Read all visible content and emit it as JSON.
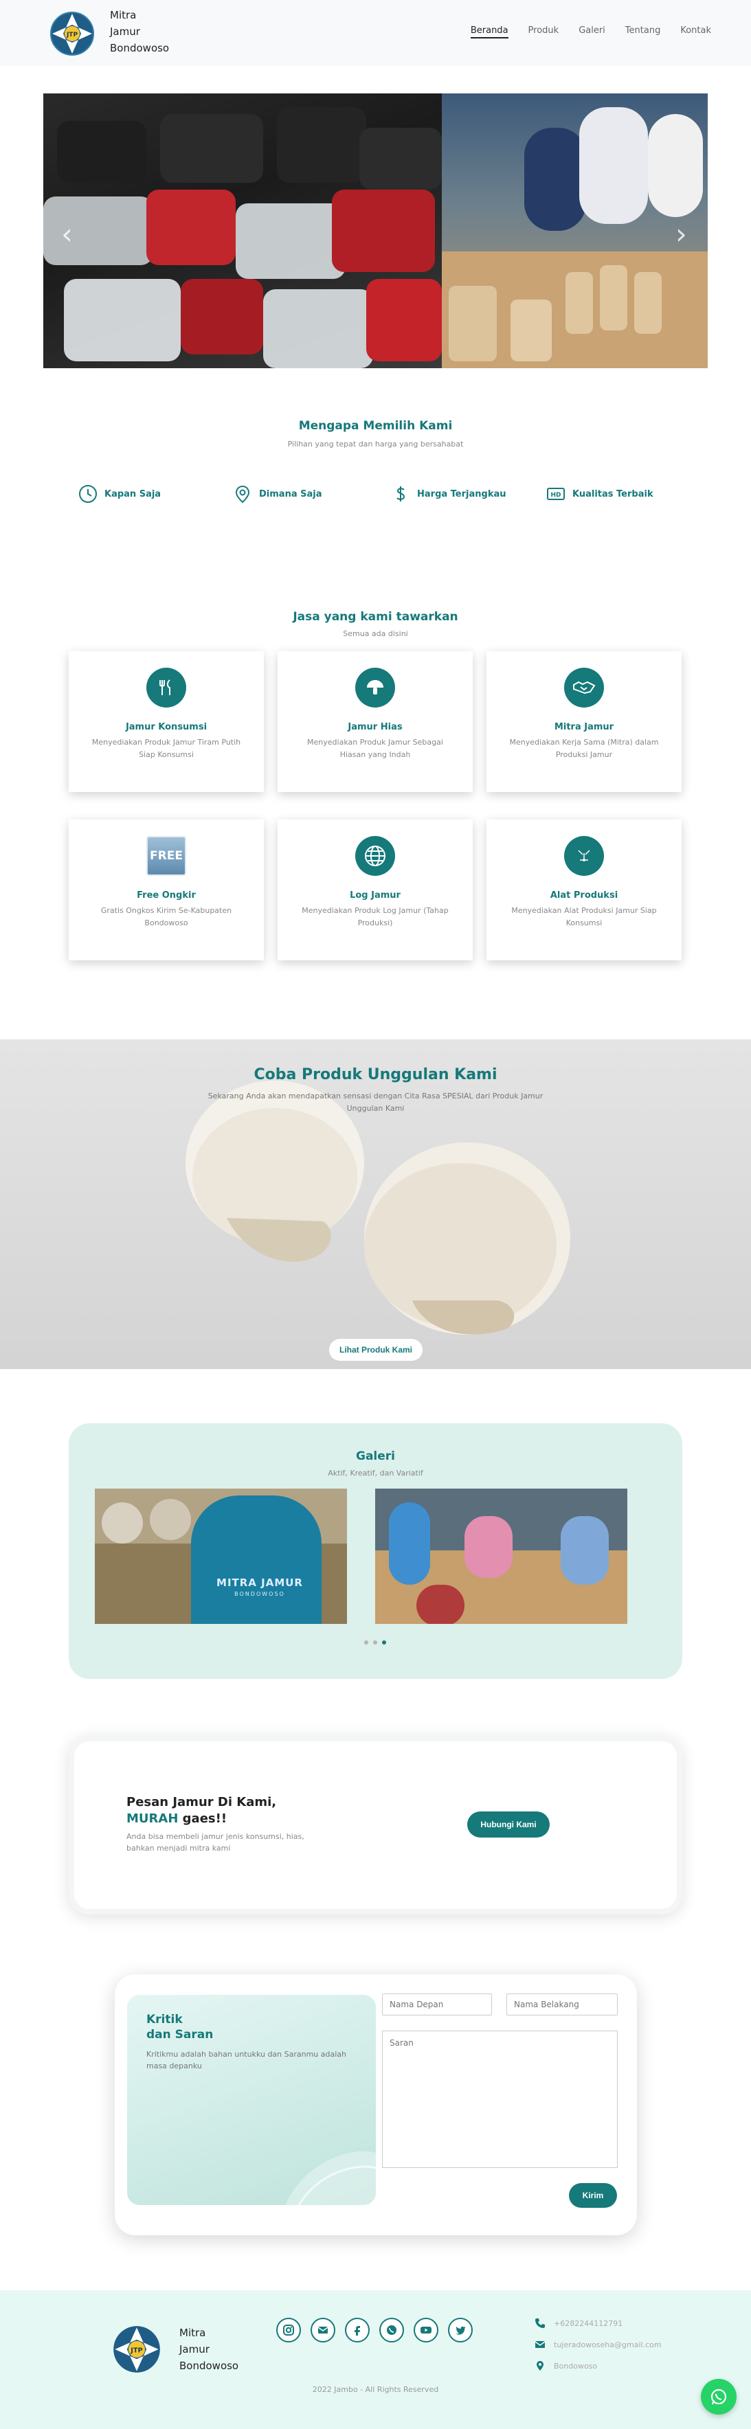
{
  "brand": {
    "line1": "Mitra",
    "line2": "Jamur",
    "line3": "Bondowoso",
    "logo_text": "JTP"
  },
  "nav": [
    {
      "label": "Beranda",
      "active": true
    },
    {
      "label": "Produk"
    },
    {
      "label": "Galeri"
    },
    {
      "label": "Tentang"
    },
    {
      "label": "Kontak"
    }
  ],
  "hero": {
    "prev_icon": "chevron-left-icon",
    "next_icon": "chevron-right-icon"
  },
  "why": {
    "title": "Mengapa Memilih Kami",
    "subtitle": "Pilihan yang tepat dan harga yang bersahabat",
    "features": [
      {
        "icon": "clock-icon",
        "label": "Kapan Saja"
      },
      {
        "icon": "location-pin-icon",
        "label": "Dimana Saja"
      },
      {
        "icon": "dollar-icon",
        "label": "Harga Terjangkau"
      },
      {
        "icon": "hd-icon",
        "label": "Kualitas Terbaik"
      }
    ]
  },
  "services": {
    "title": "Jasa yang kami tawarkan",
    "subtitle": "Semua ada disini",
    "cards": [
      {
        "icon": "utensils-icon",
        "title": "Jamur Konsumsi",
        "desc": "Menyediakan Produk Jamur Tiram Putih Siap Konsumsi"
      },
      {
        "icon": "mushroom-icon",
        "title": "Jamur Hias",
        "desc": "Menyediakan Produk Jamur Sebagai Hiasan yang Indah"
      },
      {
        "icon": "handshake-icon",
        "title": "Mitra Jamur",
        "desc": "Menyediakan Kerja Sama (Mitra) dalam Produksi Jamur"
      },
      {
        "icon": "free-icon",
        "title": "Free Ongkir",
        "desc": "Gratis Ongkos Kirim Se-Kabupaten Bondowoso",
        "badge": "FREE"
      },
      {
        "icon": "globe-icon",
        "title": "Log Jamur",
        "desc": "Menyediakan Produk Log Jamur (Tahap Produksi)"
      },
      {
        "icon": "tools-icon",
        "title": "Alat Produksi",
        "desc": "Menyediakan Alat Produksi Jamur Siap Konsumsi"
      }
    ]
  },
  "promo": {
    "title": "Coba Produk Unggulan Kami",
    "desc": "Sekarang Anda akan mendapatkan sensasi dengan Cita Rasa SPESIAL dari Produk Jamur Unggulan Kami",
    "button": "Lihat Produk Kami"
  },
  "gallery": {
    "title": "Galeri",
    "subtitle": "Aktif, Kreatif, dan Variatif",
    "shirt_text": "MITRA JAMUR",
    "shirt_sub": "BONDOWOSO"
  },
  "cta": {
    "line1": "Pesan Jamur Di Kami,",
    "accent": "MURAH",
    "line2_rest": " gaes!!",
    "desc": "Anda bisa membeli jamur jenis konsumsi, hias, bahkan menjadi mitra kami",
    "button": "Hubungi Kami"
  },
  "contact_form": {
    "title1": "Kritik",
    "title2": "dan Saran",
    "desc": "Kritikmu adalah bahan untukku dan Saranmu adalah masa depanku",
    "first_name_placeholder": "Nama Depan",
    "last_name_placeholder": "Nama Belakang",
    "message_placeholder": "Saran",
    "submit": "Kirim"
  },
  "footer": {
    "socials": [
      "instagram-icon",
      "email-icon",
      "facebook-icon",
      "whatsapp-icon",
      "youtube-icon",
      "twitter-icon"
    ],
    "phone": "+6282244112791",
    "email": "tujeradowoseha@gmail.com",
    "location": "Bondowoso",
    "copyright": "2022 Jambo - All Rights Reserved"
  },
  "colors": {
    "accent": "#16797a",
    "gallery_bg": "#dcf0ec",
    "footer_bg": "#e6f8f4"
  }
}
